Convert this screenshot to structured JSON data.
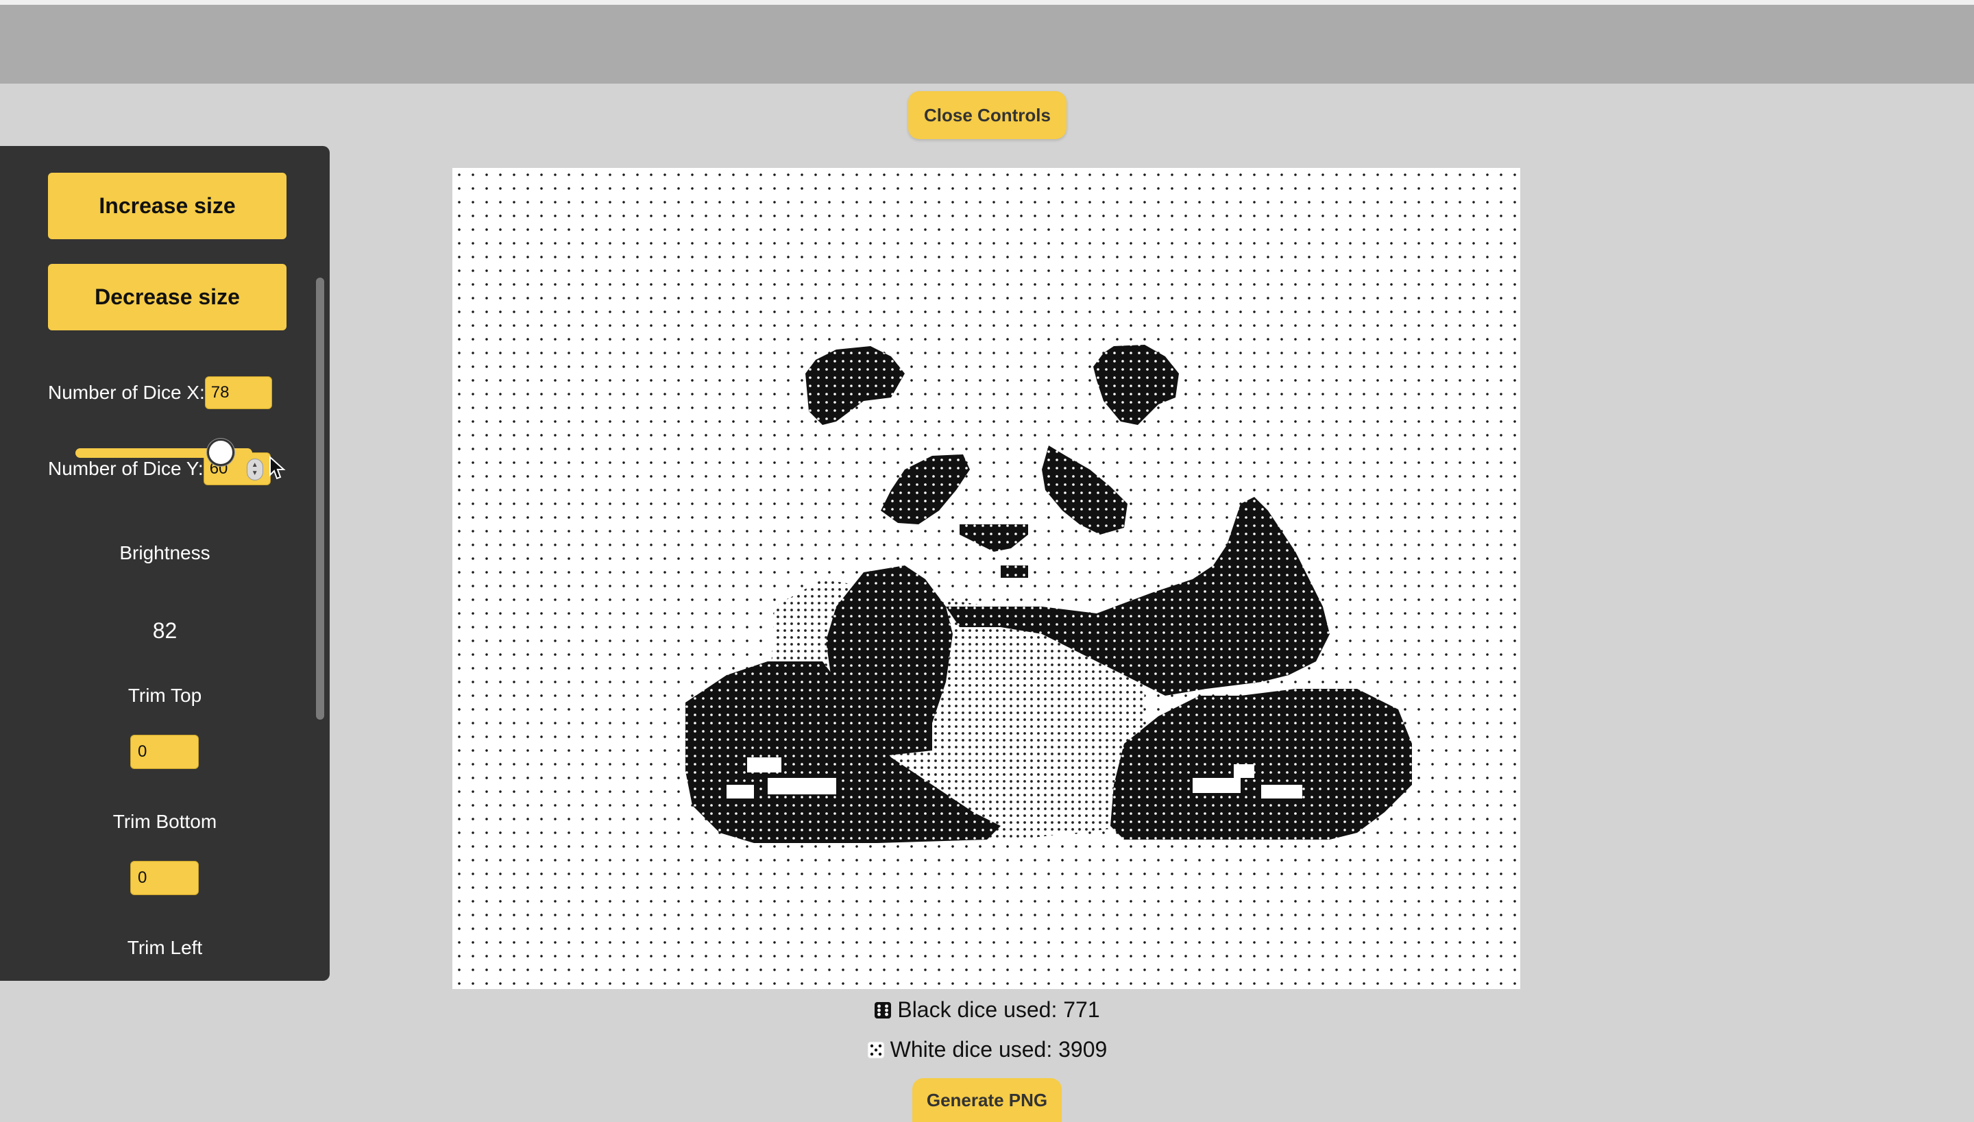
{
  "controls": {
    "close_label": "Close Controls",
    "increase_label": "Increase size",
    "decrease_label": "Decrease size",
    "dice_x_label": "Number of Dice X:",
    "dice_x_value": "78",
    "dice_y_label": "Number of Dice Y:",
    "dice_y_value": "60",
    "brightness_label": "Brightness",
    "brightness_value": "82",
    "brightness_fraction": 0.82,
    "trim_top_label": "Trim Top",
    "trim_top_value": "0",
    "trim_bottom_label": "Trim Bottom",
    "trim_bottom_value": "0",
    "trim_left_label": "Trim Left"
  },
  "stats": {
    "black_label": "Black dice used: 771",
    "white_label": "White dice used: 3909"
  },
  "actions": {
    "generate_label": "Generate PNG"
  },
  "colors": {
    "accent": "#f6cc48",
    "panel": "#333333",
    "page_bg": "#d3d3d3",
    "topbar": "#ababab"
  },
  "icons": {
    "black_die": "die-six-black-icon",
    "white_die": "die-five-white-icon",
    "cursor": "mouse-pointer-icon"
  }
}
